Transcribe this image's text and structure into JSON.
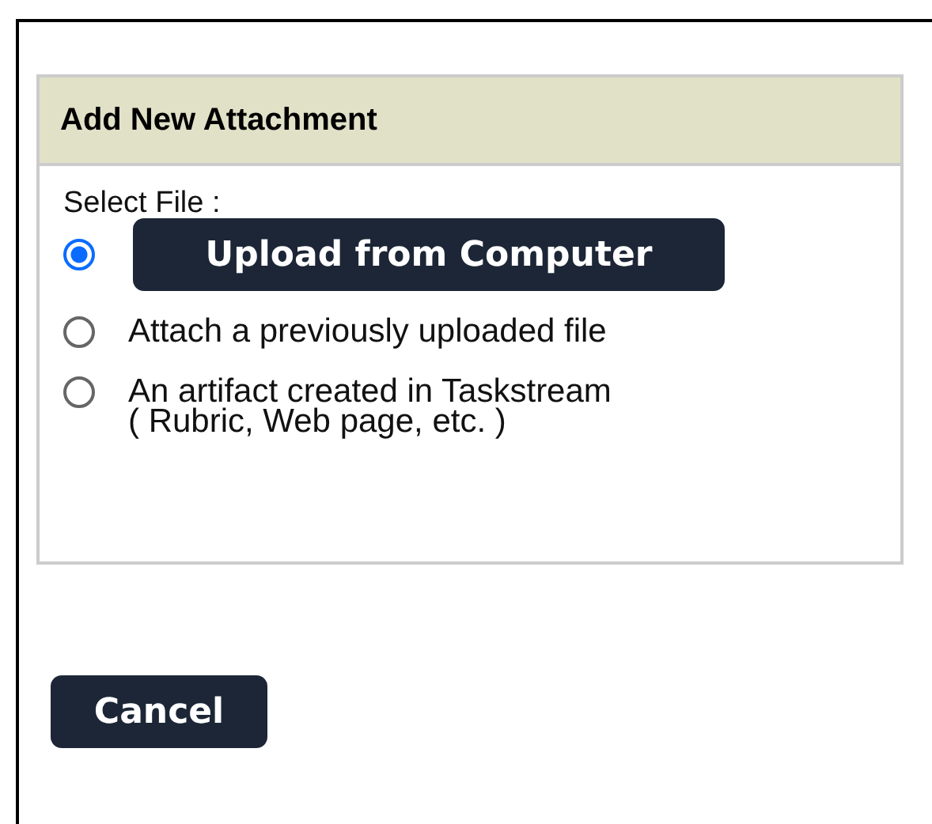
{
  "panel": {
    "title": "Add New Attachment",
    "prompt": "Select File :",
    "options": [
      {
        "kind": "button",
        "label": "Upload from Computer",
        "selected": true
      },
      {
        "kind": "text",
        "label": "Attach a previously uploaded file",
        "selected": false
      },
      {
        "kind": "text",
        "label": "An artifact created in Taskstream",
        "note": "( Rubric, Web page, etc. )",
        "selected": false
      }
    ]
  },
  "buttons": [
    {
      "label": "Cancel"
    }
  ]
}
